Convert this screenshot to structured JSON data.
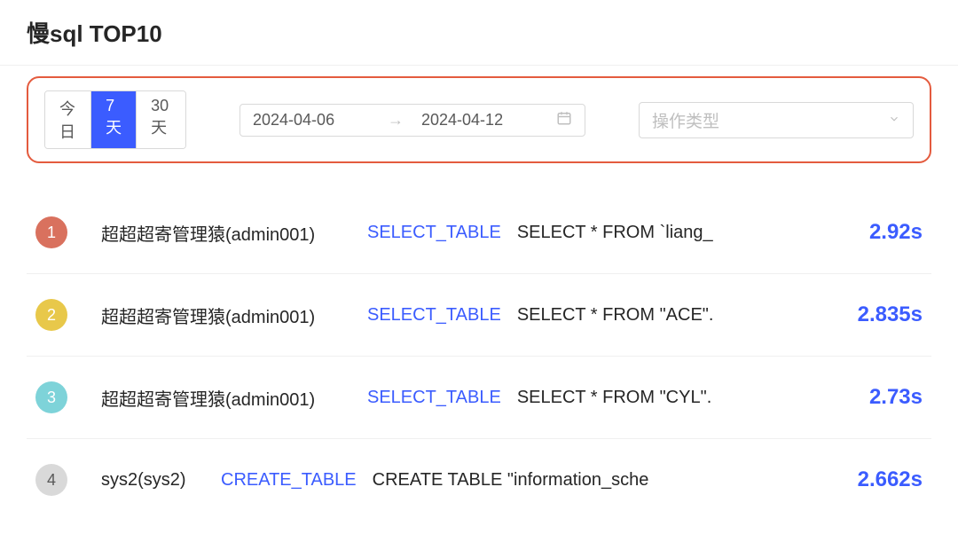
{
  "title": "慢sql TOP10",
  "filters": {
    "segments": [
      "今日",
      "7 天",
      "30 天"
    ],
    "active_segment_index": 1,
    "date_start": "2024-04-06",
    "date_end": "2024-04-12",
    "type_placeholder": "操作类型"
  },
  "rows": [
    {
      "rank": "1",
      "user": "超超超寄管理猿(admin001)",
      "op": "SELECT_TABLE",
      "sql": "SELECT * FROM `liang_",
      "duration": "2.92s"
    },
    {
      "rank": "2",
      "user": "超超超寄管理猿(admin001)",
      "op": "SELECT_TABLE",
      "sql": "SELECT * FROM \"ACE\".",
      "duration": "2.835s"
    },
    {
      "rank": "3",
      "user": "超超超寄管理猿(admin001)",
      "op": "SELECT_TABLE",
      "sql": "SELECT * FROM \"CYL\".",
      "duration": "2.73s"
    },
    {
      "rank": "4",
      "user": "sys2(sys2)",
      "op": "CREATE_TABLE",
      "sql": "CREATE TABLE \"information_sche",
      "duration": "2.662s"
    }
  ]
}
